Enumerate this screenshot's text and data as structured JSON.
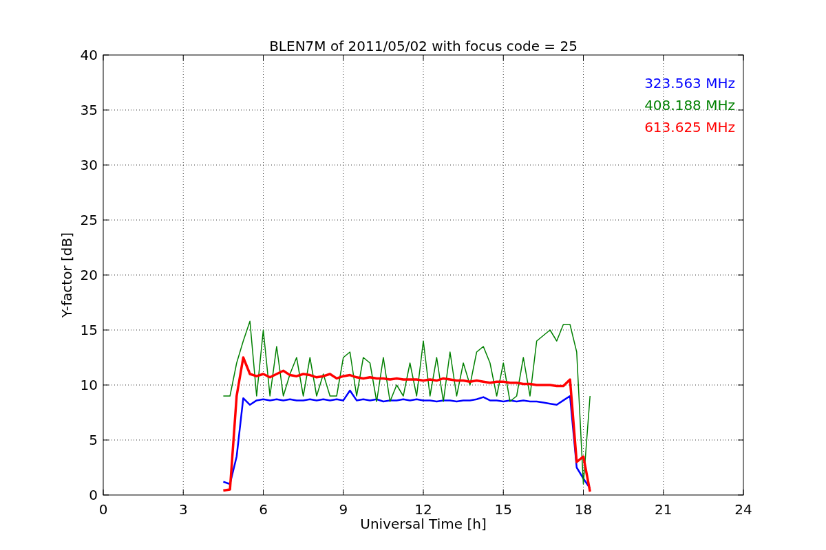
{
  "chart_data": {
    "type": "line",
    "title": "BLEN7M of 2011/05/02 with focus code = 25",
    "xlabel": "Universal Time [h]",
    "ylabel": "Y-factor [dB]",
    "x": [
      4.5,
      4.75,
      5.0,
      5.25,
      5.5,
      5.75,
      6.0,
      6.25,
      6.5,
      6.75,
      7.0,
      7.25,
      7.5,
      7.75,
      8.0,
      8.25,
      8.5,
      8.75,
      9.0,
      9.25,
      9.5,
      9.75,
      10.0,
      10.25,
      10.5,
      10.75,
      11.0,
      11.25,
      11.5,
      11.75,
      12.0,
      12.25,
      12.5,
      12.75,
      13.0,
      13.25,
      13.5,
      13.75,
      14.0,
      14.25,
      14.5,
      14.75,
      15.0,
      15.25,
      15.5,
      15.75,
      16.0,
      16.25,
      16.5,
      16.75,
      17.0,
      17.25,
      17.5,
      17.75,
      18.0,
      18.25
    ],
    "series": [
      {
        "name": "323.563 MHz",
        "color": "#0000ff",
        "values": [
          1.2,
          1.0,
          3.5,
          8.8,
          8.2,
          8.6,
          8.7,
          8.6,
          8.7,
          8.6,
          8.7,
          8.6,
          8.6,
          8.7,
          8.6,
          8.7,
          8.6,
          8.7,
          8.6,
          9.5,
          8.6,
          8.7,
          8.6,
          8.7,
          8.5,
          8.6,
          8.6,
          8.7,
          8.6,
          8.7,
          8.6,
          8.6,
          8.5,
          8.6,
          8.6,
          8.5,
          8.6,
          8.6,
          8.7,
          8.9,
          8.6,
          8.6,
          8.5,
          8.6,
          8.5,
          8.6,
          8.5,
          8.5,
          8.4,
          8.3,
          8.2,
          8.6,
          9.0,
          2.5,
          1.5,
          0.6
        ]
      },
      {
        "name": "408.188 MHz",
        "color": "#008000",
        "values": [
          9,
          9,
          12,
          14,
          15.8,
          9,
          15,
          9,
          13.5,
          9,
          11,
          12.5,
          9,
          12.5,
          9,
          11,
          9,
          9,
          12.5,
          13,
          9,
          12.5,
          12,
          8.5,
          12.5,
          8.5,
          10,
          9,
          12,
          9,
          14,
          9,
          12.5,
          8.5,
          13,
          9,
          12,
          10,
          13,
          13.5,
          12,
          9,
          12,
          8.5,
          9,
          12.5,
          9,
          14,
          14.5,
          15,
          14,
          15.5,
          15.5,
          13,
          1,
          9
        ]
      },
      {
        "name": "613.625 MHz",
        "color": "#ff0000",
        "values": [
          0.4,
          0.5,
          9,
          12.5,
          11,
          10.8,
          11,
          10.7,
          11,
          11.3,
          10.9,
          10.8,
          11,
          10.9,
          10.7,
          10.8,
          11,
          10.6,
          10.8,
          10.9,
          10.7,
          10.6,
          10.7,
          10.6,
          10.6,
          10.5,
          10.6,
          10.5,
          10.5,
          10.5,
          10.4,
          10.5,
          10.4,
          10.6,
          10.5,
          10.4,
          10.4,
          10.3,
          10.4,
          10.3,
          10.2,
          10.3,
          10.3,
          10.2,
          10.2,
          10.1,
          10.1,
          10.0,
          10.0,
          10.0,
          9.9,
          9.9,
          10.5,
          3,
          3.5,
          0.3
        ]
      }
    ],
    "xlim": [
      0,
      24
    ],
    "ylim": [
      0,
      40
    ],
    "xticks": [
      0,
      3,
      6,
      9,
      12,
      15,
      18,
      21,
      24
    ],
    "yticks": [
      0,
      5,
      10,
      15,
      20,
      25,
      30,
      35,
      40
    ],
    "grid": true
  }
}
